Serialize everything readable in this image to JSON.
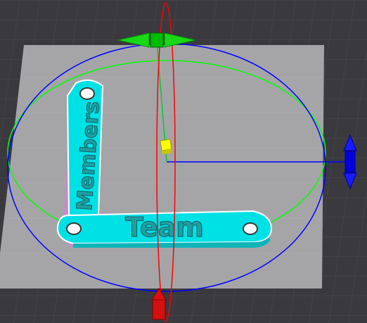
{
  "viewport": {
    "background": "#3a3a3e",
    "grid_color": "#4a4a4f",
    "build_plate_color": "#a5a5a8"
  },
  "model": {
    "color": "#00e1e6",
    "shadow_color": "#d081d6",
    "engraved_text": [
      "Members",
      "Team"
    ]
  },
  "gizmo": {
    "x_axis_color": "#0000ff",
    "y_axis_color": "#00ff00",
    "z_axis_color": "#ff0000",
    "center_color": "#ffff00",
    "icons": [
      "move-x-arrow-icon",
      "move-y-arrow-icon",
      "move-z-arrow-icon",
      "center-handle-icon"
    ]
  }
}
